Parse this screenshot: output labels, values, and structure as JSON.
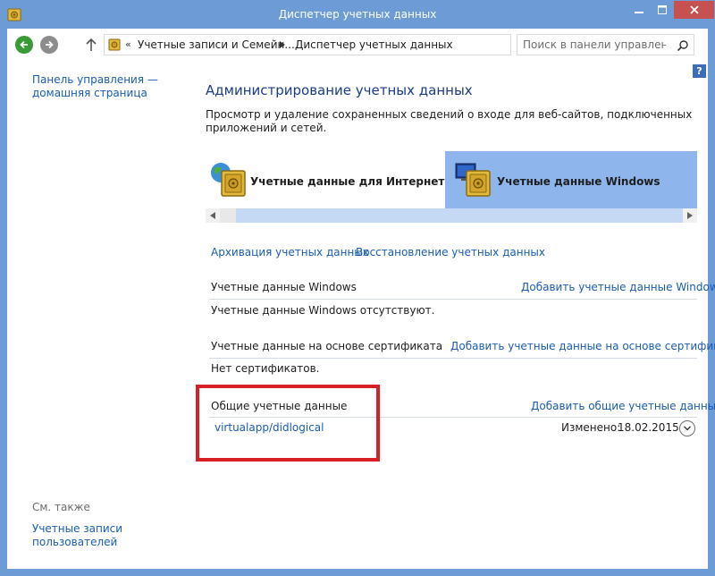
{
  "window": {
    "title": "Диспетчер учетных данных",
    "accent_color": "#6c9bd6",
    "close_color": "#c75050",
    "icons": [
      "credential-manager-icon",
      "minimize-icon",
      "maximize-icon",
      "close-icon"
    ]
  },
  "navbar": {
    "breadcrumb_overflow": "«",
    "breadcrumb": [
      "Учетные записи и Семейн...",
      "Диспетчер учетных данных"
    ],
    "search_placeholder": "Поиск в панели управления",
    "icons": [
      "back-arrow-icon",
      "forward-arrow-icon",
      "up-arrow-icon",
      "search-icon"
    ]
  },
  "help": {
    "label": "?"
  },
  "left_pane": {
    "home_link": "Панель управления — домашняя страница",
    "see_also_title": "См. также",
    "see_also_link": "Учетные записи пользователей"
  },
  "main": {
    "title": "Администрирование учетных данных",
    "description": "Просмотр и удаление сохраненных сведений о входе для веб-сайтов, подключенных приложений и сетей.",
    "tabs": [
      {
        "label": "Учетные данные для Интернета",
        "icon": "web-credentials-vault-icon",
        "selected": false
      },
      {
        "label": "Учетные данные Windows",
        "icon": "windows-credentials-vault-icon",
        "selected": true
      }
    ],
    "selected_tab_color": "#8eb5ec",
    "actions": {
      "backup": "Архивация учетных данных",
      "restore": "Восстановление учетных данных"
    },
    "sections": {
      "windows": {
        "title": "Учетные данные Windows",
        "add": "Добавить учетные данные Windows",
        "empty": "Учетные данные Windows отсутствуют."
      },
      "certificate": {
        "title": "Учетные данные на основе сертификата",
        "add": "Добавить учетные данные на основе сертификата",
        "empty": "Нет сертификатов."
      },
      "generic": {
        "title": "Общие учетные данные",
        "add": "Добавить общие учетные данные",
        "items": [
          {
            "name": "virtualapp/didlogical",
            "modified_label": "Изменено:",
            "modified_date": "18.02.2015"
          }
        ]
      }
    },
    "highlight_color": "#d81f26",
    "link_color": "#1a5cb3"
  }
}
